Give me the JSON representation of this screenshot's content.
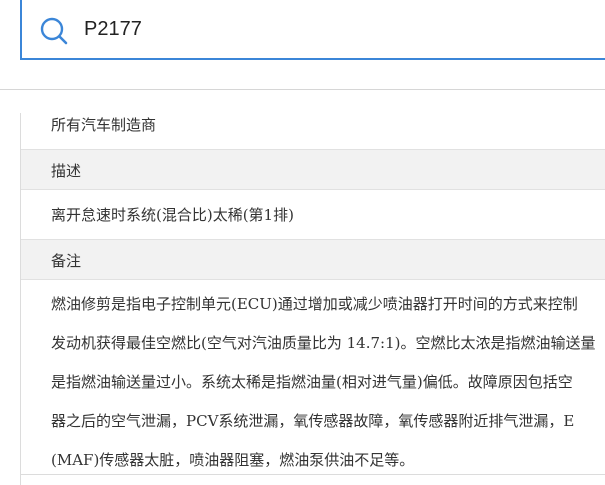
{
  "search": {
    "value": "P2177"
  },
  "details": {
    "manufacturer_value": "所有汽车制造商",
    "description_label": "描述",
    "description_value": "离开怠速时系统(混合比)太稀(第1排)",
    "remarks_label": "备注",
    "remarks_lines": [
      "燃油修剪是指电子控制单元(ECU)通过增加或减少喷油器打开时间的方式来控制",
      "发动机获得最佳空燃比(空气对汽油质量比为 14.7:1)。空燃比太浓是指燃油输送量",
      "是指燃油输送量过小。系统太稀是指燃油量(相对进气量)偏低。故障原因包括空",
      "器之后的空气泄漏，PCV系统泄漏，氧传感器故障，氧传感器附近排气泄漏，E",
      "(MAF)传感器太脏，喷油器阻塞，燃油泵供油不足等。"
    ]
  },
  "colors": {
    "accent": "#3b86d8",
    "header_bg": "#f2f2f2",
    "text": "#333333"
  },
  "icons": {
    "search": "search-icon"
  }
}
